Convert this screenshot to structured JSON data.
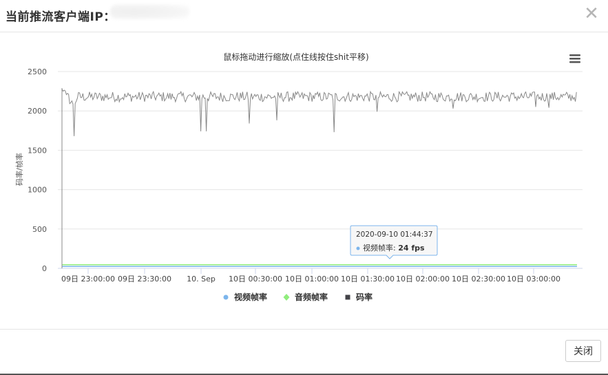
{
  "dialog": {
    "title": "当前推流客户端IP：",
    "close_icon": "close-icon",
    "close_button_label": "关闭"
  },
  "chart_data": {
    "type": "line",
    "title": "鼠标拖动进行缩放(点住线按住shit平移)",
    "ylabel": "码率/帧率",
    "ylim": [
      0,
      2500
    ],
    "y_ticks": [
      "0",
      "500",
      "1000",
      "1500",
      "2000",
      "2500"
    ],
    "x_tick_labels": [
      "09日 23:00:00",
      "09日 23:30:00",
      "10. Sep",
      "10日 00:30:00",
      "10日 01:00:00",
      "10日 01:30:00",
      "10日 02:00:00",
      "10日 02:30:00",
      "10日 03:00:00"
    ],
    "grid": true,
    "legend_position": "bottom-center",
    "menu_icon": "hamburger-menu-icon",
    "series": [
      {
        "name": "视频帧率",
        "color": "#7cb5ec",
        "marker": "circle",
        "approx_value": 24
      },
      {
        "name": "音频帧率",
        "color": "#90ed7d",
        "marker": "diamond",
        "approx_value": 46
      },
      {
        "name": "码率",
        "color": "#434348",
        "marker": "square",
        "typical_value": 2180,
        "min_value": 1650,
        "max_value": 2290
      }
    ],
    "tooltip": {
      "time": "2020-09-10 01:44:37",
      "series_name": "视频帧率",
      "value_text": "24 fps"
    }
  }
}
